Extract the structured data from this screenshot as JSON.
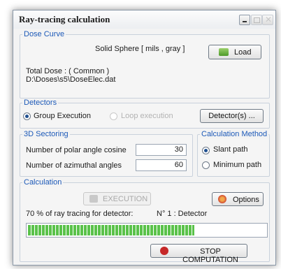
{
  "window": {
    "title": "Ray-tracing calculation"
  },
  "dose_curve": {
    "group_label": "Dose Curve",
    "shape": "Solid Sphere [ mils , gray ]",
    "load_label": "Load",
    "total_dose": "Total Dose : ( Common )",
    "file_path": "D:\\Doses\\s5\\DoseElec.dat"
  },
  "detectors": {
    "group_label": "Detectors",
    "group_execution": "Group Execution",
    "loop_execution": "Loop execution",
    "detectors_button": "Detector(s) ..."
  },
  "sectoring": {
    "group_label": "3D Sectoring",
    "polar_label": "Number of polar angle cosine",
    "polar_value": "30",
    "azimuthal_label": "Number of azimuthal angles",
    "azimuthal_value": "60"
  },
  "method": {
    "group_label": "Calculation Method",
    "slant": "Slant path",
    "minimum": "Minimum path"
  },
  "calculation": {
    "group_label": "Calculation",
    "execution_label": "EXECUTION",
    "options_label": "Options",
    "status": "70 % of ray tracing for detector:",
    "detector_name": "N° 1 : Detector",
    "progress_fraction": 0.7,
    "stop_label": "STOP COMPUTATION"
  },
  "colors": {
    "accent": "#1c59b8",
    "progress": "#5ac24a",
    "stop": "#c62828"
  },
  "icons": [
    "minimize-icon",
    "maximize-icon",
    "close-icon",
    "load-icon",
    "execution-icon",
    "options-icon",
    "stop-icon"
  ]
}
